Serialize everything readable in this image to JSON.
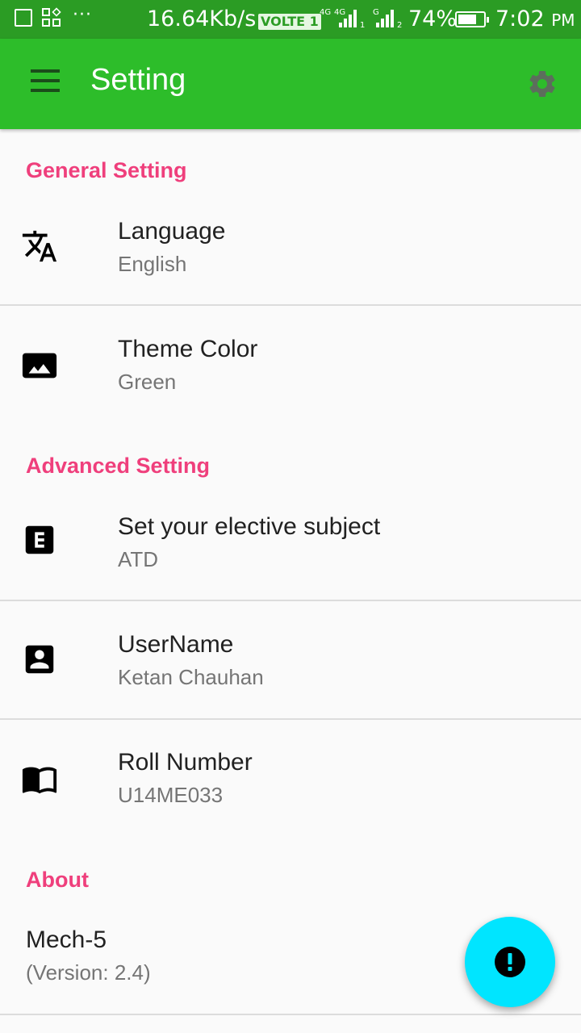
{
  "status_bar": {
    "net_speed": "16.64Kb/s",
    "volte_label": "VOLTE 1",
    "net_type_1": "4G",
    "net_type_2": "4G",
    "net_type_3": "G",
    "sim_1": "1",
    "sim_2": "2",
    "battery_percent": "74%",
    "battery_level": 0.74,
    "time": "7:02",
    "ampm": "PM"
  },
  "app_bar": {
    "title": "Setting",
    "menu_icon": "menu-icon",
    "settings_icon": "gear-icon",
    "color": "#2dbd2a"
  },
  "sections": {
    "general": {
      "header": "General Setting",
      "items": [
        {
          "title": "Language",
          "value": "English",
          "icon": "translate-icon"
        },
        {
          "title": "Theme Color",
          "value": "Green",
          "icon": "image-icon"
        }
      ]
    },
    "advanced": {
      "header": "Advanced Setting",
      "items": [
        {
          "title": "Set your elective subject",
          "value": "ATD",
          "icon": "letter-e-icon"
        },
        {
          "title": "UserName",
          "value": "Ketan Chauhan",
          "icon": "contact-icon"
        },
        {
          "title": "Roll Number",
          "value": "U14ME033",
          "icon": "book-icon"
        }
      ]
    },
    "about": {
      "header": "About",
      "app_name": "Mech-5",
      "version": "(Version: 2.4)"
    }
  },
  "fab": {
    "icon": "exclamation-icon",
    "color": "#00e5ff"
  },
  "colors": {
    "accent": "#ef3f7c",
    "status_bar": "#2b9c24"
  }
}
